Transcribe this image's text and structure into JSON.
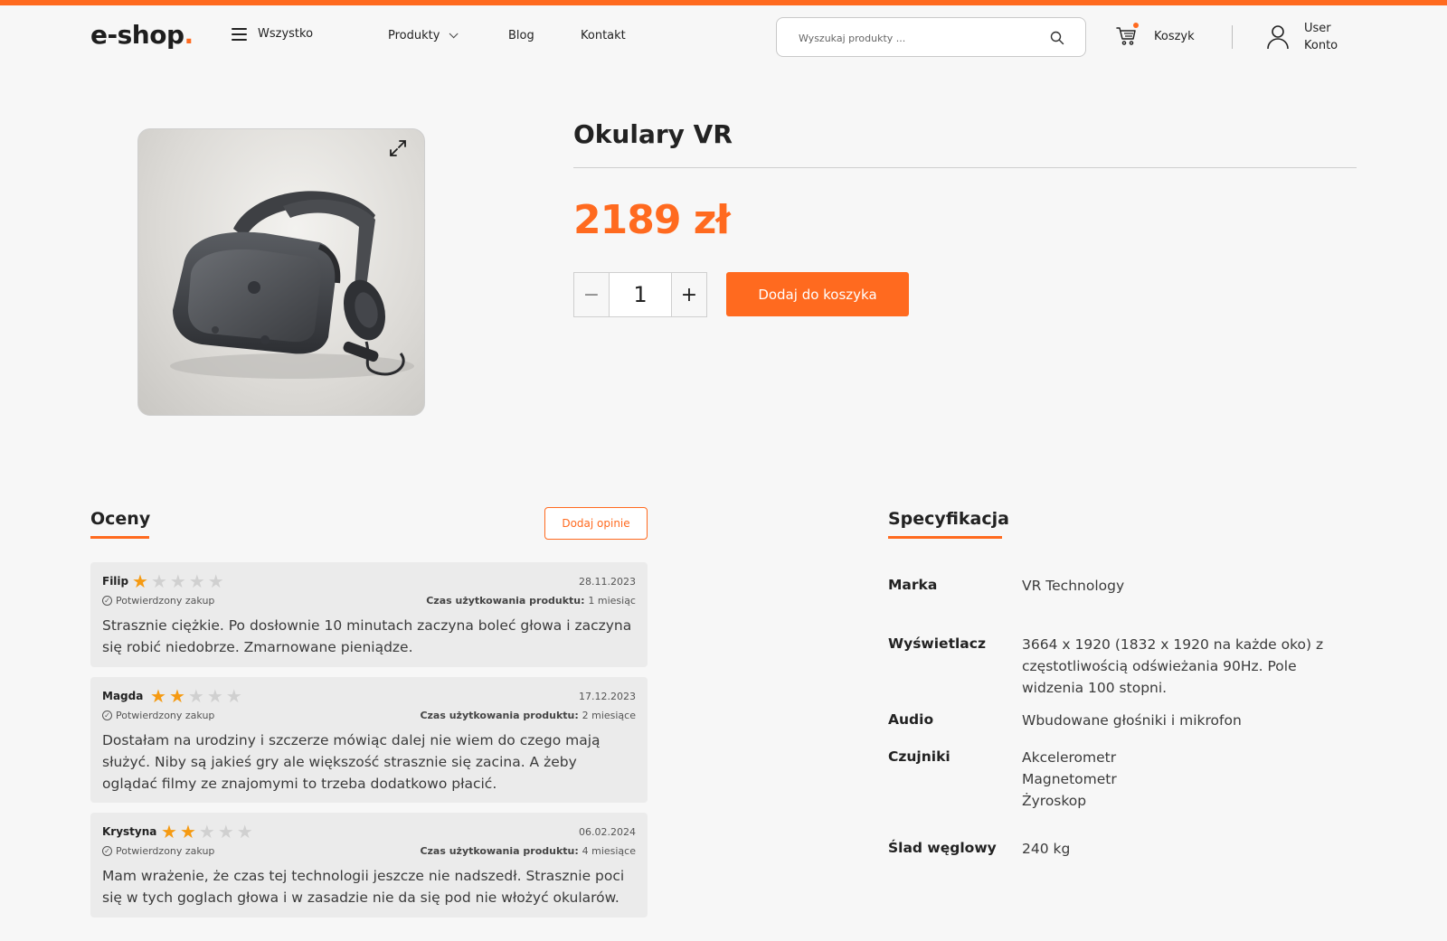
{
  "header": {
    "logo_text": "e-shop",
    "logo_dot": ".",
    "nav_all": "Wszystko",
    "nav_products": "Produkty",
    "nav_blog": "Blog",
    "nav_contact": "Kontakt",
    "search_placeholder": "Wyszukaj produkty ...",
    "cart_label": "Koszyk",
    "user_name": "User",
    "account_label": "Konto"
  },
  "product": {
    "title": "Okulary VR",
    "price": "2189 zł",
    "quantity": "1",
    "qty_minus": "−",
    "qty_plus": "+",
    "add_to_cart": "Dodaj do koszyka",
    "image_desc": "vr-headset-image"
  },
  "reviews": {
    "title": "Oceny",
    "add_button": "Dodaj opinie",
    "usage_label": "Czas użytkowania produktu:",
    "verified_label": "Potwierdzony zakup",
    "items": [
      {
        "name": "Filip",
        "rating": 1,
        "date": "28.11.2023",
        "usage": "1 miesiąc",
        "text": "Strasznie ciężkie. Po dosłownie 10 minutach zaczyna boleć głowa i zaczyna się robić niedobrze. Zmarnowane pieniądze."
      },
      {
        "name": "Magda",
        "rating": 2,
        "date": "17.12.2023",
        "usage": "2 miesiące",
        "text": "Dostałam na urodziny i szczerze mówiąc dalej nie wiem do czego mają służyć. Niby są jakieś gry ale większość strasznie się zacina. A żeby oglądać filmy ze znajomymi to trzeba dodatkowo płacić."
      },
      {
        "name": "Krystyna",
        "rating": 2,
        "date": "06.02.2024",
        "usage": "4 miesiące",
        "text": "Mam wrażenie, że czas tej technologii jeszcze nie nadszedł. Strasznie poci się w tych goglach głowa i w zasadzie nie da się pod nie włożyć okularów."
      }
    ]
  },
  "spec": {
    "title": "Specyfikacja",
    "rows": [
      {
        "label": "Marka",
        "value": "VR Technology"
      },
      {
        "label": "Wyświetlacz",
        "value": "3664 x 1920 (1832 x 1920 na każde oko) z częstotliwością odświeżania 90Hz. Pole widzenia 100 stopni."
      },
      {
        "label": "Audio",
        "value": "Wbudowane głośniki i mikrofon"
      },
      {
        "label": "Czujniki",
        "value": "Akcelerometr\nMagnetometr\nŻyroskop"
      },
      {
        "label": "Ślad węglowy",
        "value": "240 kg"
      }
    ]
  },
  "colors": {
    "accent": "#ff6a1f",
    "star_on": "#f59a12",
    "star_off": "#d0d0d0"
  }
}
